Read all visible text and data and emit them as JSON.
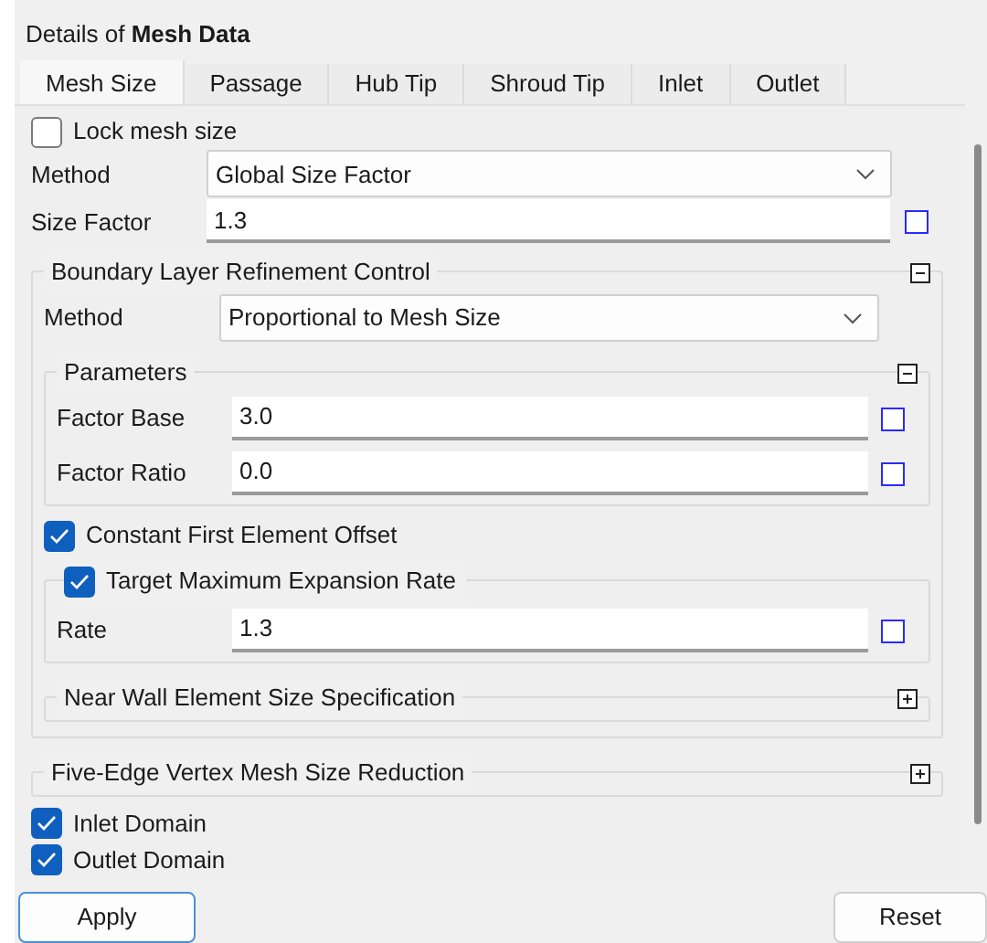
{
  "panel": {
    "title": "Details of **Mesh Data**"
  },
  "tabs": [
    {
      "label": "Mesh Size",
      "selected": true
    },
    {
      "label": "Passage",
      "selected": false
    },
    {
      "label": "Hub Tip",
      "selected": false
    },
    {
      "label": "Shroud Tip",
      "selected": false
    },
    {
      "label": "Inlet",
      "selected": false
    },
    {
      "label": "Outlet",
      "selected": false
    }
  ],
  "lock_mesh_size": {
    "label": "Lock mesh size",
    "checked": false
  },
  "method": {
    "label": "Method",
    "value": "Global Size Factor"
  },
  "size_factor": {
    "label": "Size Factor",
    "value": "1.3"
  },
  "boundary_layer": {
    "title": "Boundary Layer Refinement Control",
    "expanded": true,
    "method": {
      "label": "Method",
      "value": "Proportional to Mesh Size"
    },
    "parameters": {
      "title": "Parameters",
      "expanded": true,
      "fields": [
        {
          "label": "Factor Base",
          "value": "3.0"
        },
        {
          "label": "Factor Ratio",
          "value": "0.0"
        }
      ]
    },
    "constant_first_element_offset": {
      "label": "Constant First Element Offset",
      "checked": true
    },
    "target_max_expansion_rate": {
      "label": "Target Maximum Expansion Rate",
      "checked": true,
      "rate": {
        "label": "Rate",
        "value": "1.3"
      }
    },
    "near_wall": {
      "title": "Near Wall Element Size Specification",
      "expanded": false
    }
  },
  "five_edge": {
    "title": "Five-Edge Vertex Mesh Size Reduction",
    "expanded": false
  },
  "domains": [
    {
      "label": "Inlet Domain",
      "checked": true
    },
    {
      "label": "Outlet Domain",
      "checked": true
    }
  ],
  "buttons": [
    "Apply",
    "Reset"
  ]
}
